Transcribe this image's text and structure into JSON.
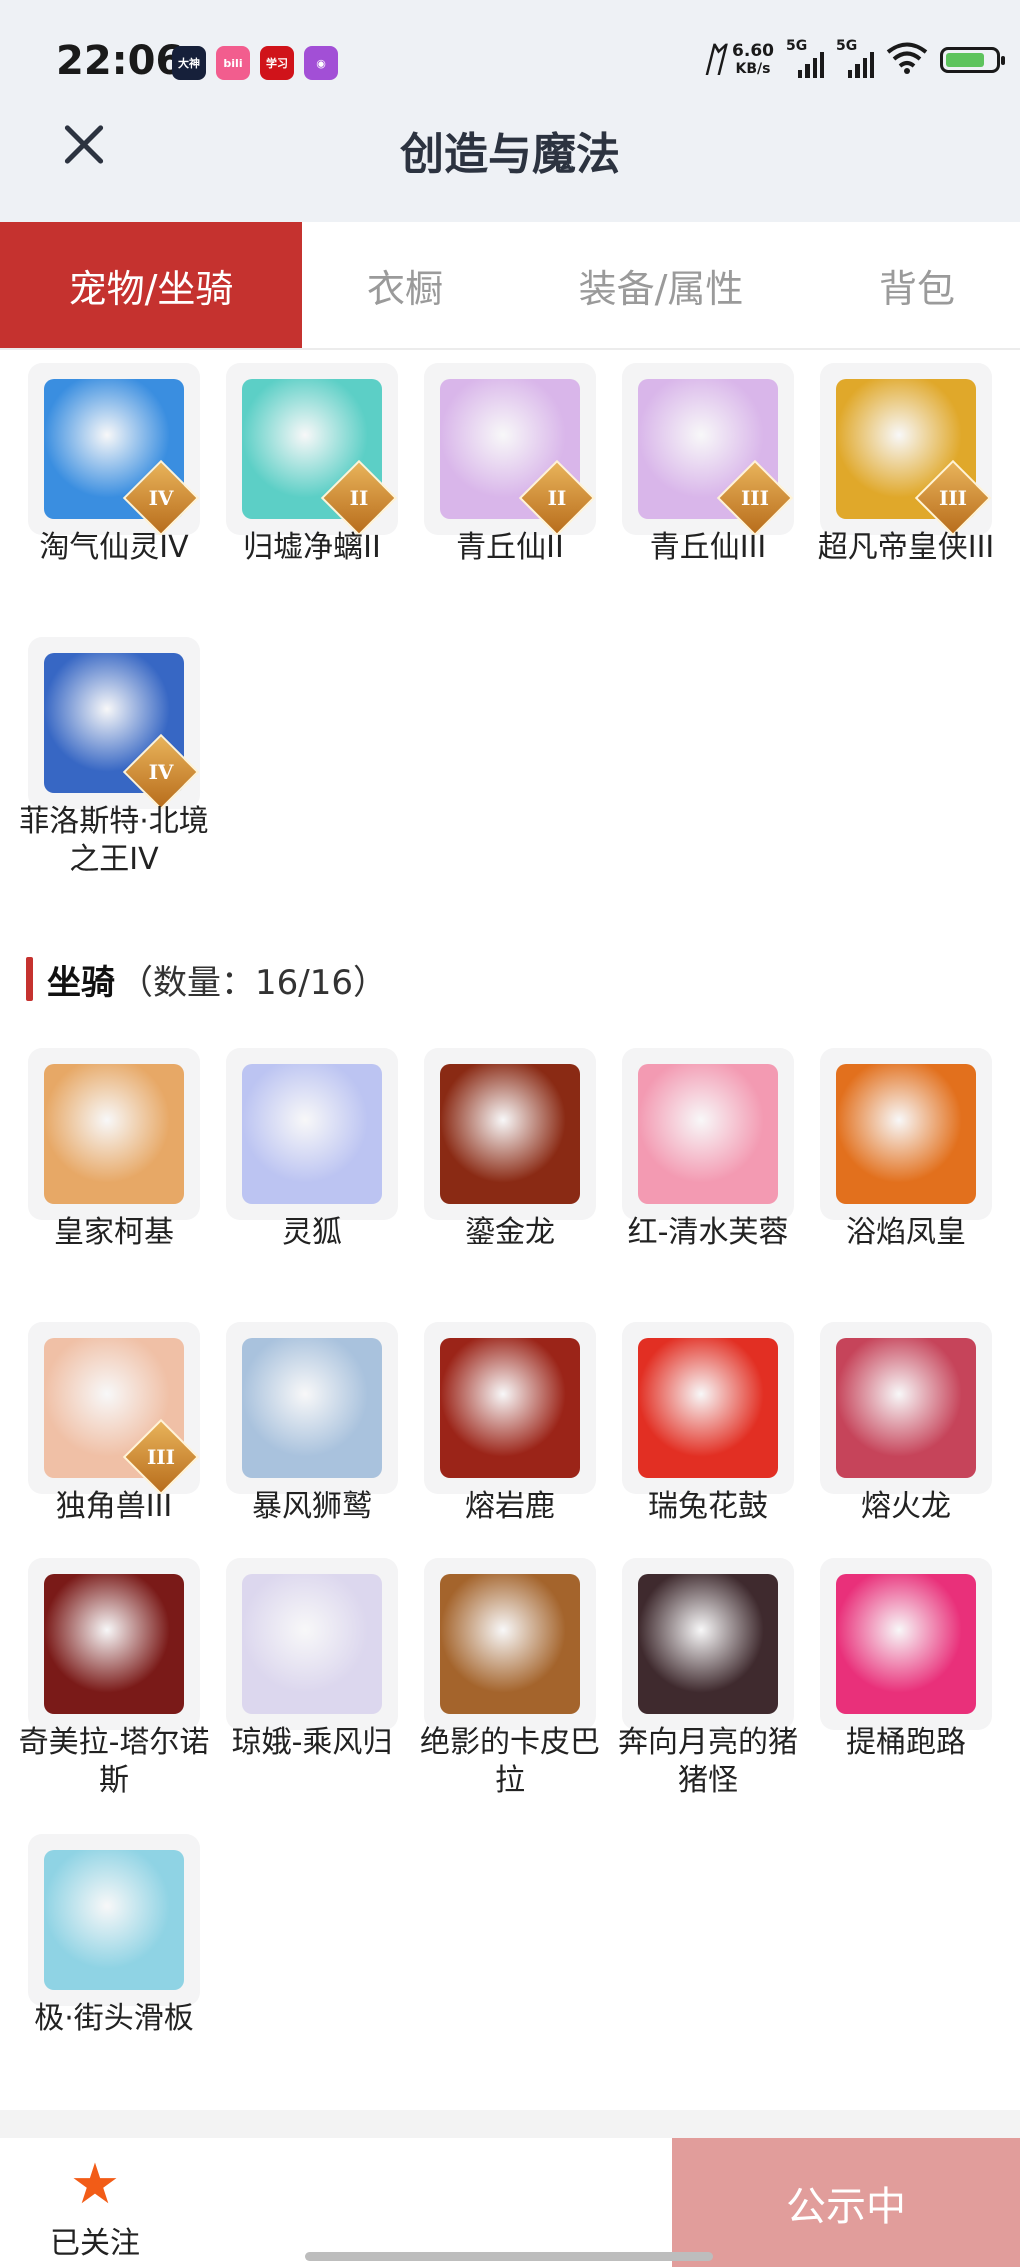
{
  "status_bar": {
    "time": "22:06",
    "apps": [
      {
        "name": "dashen-app-icon",
        "label": "大神",
        "color": "#16203a"
      },
      {
        "name": "bilibili-app-icon",
        "label": "bili",
        "color": "#f25d8e"
      },
      {
        "name": "xuexi-app-icon",
        "label": "学习",
        "color": "#d0131a"
      },
      {
        "name": "podcast-app-icon",
        "label": "◉",
        "color": "#a24fd6"
      }
    ],
    "net_speed_value": "6.60",
    "net_speed_unit": "KB/s",
    "signal1_label": "5G",
    "signal2_label": "5G",
    "battery_color": "#5dc35d"
  },
  "header": {
    "title": "创造与魔法",
    "close_icon": "close-icon"
  },
  "tabs": [
    {
      "label": "宠物/坐骑",
      "active": true
    },
    {
      "label": "衣橱",
      "active": false
    },
    {
      "label": "装备/属性",
      "active": false
    },
    {
      "label": "背包",
      "active": false
    }
  ],
  "pets": [
    {
      "name": "淘气仙灵IV",
      "badge": "IV",
      "icon": "blue-puppy-icon",
      "bg": "#3a8ee0"
    },
    {
      "name": "归墟净螭II",
      "badge": "II",
      "icon": "cyan-dragon-icon",
      "bg": "#5ccfc6"
    },
    {
      "name": "青丘仙II",
      "badge": "II",
      "icon": "fox-fairy-icon",
      "bg": "#d9b6ea"
    },
    {
      "name": "青丘仙III",
      "badge": "III",
      "icon": "fox-fairy-icon",
      "bg": "#d9b6ea"
    },
    {
      "name": "超凡帝皇侠III",
      "badge": "III",
      "icon": "golden-armor-icon",
      "bg": "#e0a82a"
    },
    {
      "name": "菲洛斯特·北境之王IV",
      "badge": "IV",
      "icon": "frost-king-icon",
      "bg": "#3767c4"
    }
  ],
  "mounts_section": {
    "title": "坐骑",
    "count": "（数量：16/16）"
  },
  "mounts": [
    {
      "name": "皇家柯基",
      "icon": "corgi-icon",
      "bg": "#e7a866"
    },
    {
      "name": "灵狐",
      "icon": "spirit-fox-icon",
      "bg": "#bcc4f2"
    },
    {
      "name": "鎏金龙",
      "icon": "gold-dragon-icon",
      "bg": "#8a2a14"
    },
    {
      "name": "红-清水芙蓉",
      "icon": "lotus-icon",
      "bg": "#f39ab2"
    },
    {
      "name": "浴焰凤皇",
      "icon": "phoenix-icon",
      "bg": "#e2701d"
    },
    {
      "name": "独角兽III",
      "badge": "III",
      "icon": "unicorn-icon",
      "bg": "#f0c0a6"
    },
    {
      "name": "暴风狮鹫",
      "icon": "griffin-icon",
      "bg": "#a9c2dd"
    },
    {
      "name": "熔岩鹿",
      "icon": "lava-deer-icon",
      "bg": "#9b2418"
    },
    {
      "name": "瑞兔花鼓",
      "icon": "rabbit-drum-icon",
      "bg": "#e22f23"
    },
    {
      "name": "熔火龙",
      "icon": "fire-dragon-icon",
      "bg": "#c6445a"
    },
    {
      "name": "奇美拉-塔尔诺斯",
      "icon": "chimera-icon",
      "bg": "#7a1a18"
    },
    {
      "name": "琼娥-乘风归",
      "icon": "moon-lady-icon",
      "bg": "#dcd7ee"
    },
    {
      "name": "绝影的卡皮巴拉",
      "icon": "capybara-icon",
      "bg": "#a4642c"
    },
    {
      "name": "奔向月亮的猪猪怪",
      "icon": "pig-monster-icon",
      "bg": "#3f2a2e"
    },
    {
      "name": "提桶跑路",
      "icon": "bucket-icon",
      "bg": "#e9307a"
    },
    {
      "name": "极·街头滑板",
      "icon": "skateboard-icon",
      "bg": "#8fd3e4"
    }
  ],
  "bottom": {
    "follow_label": "已关注",
    "follow_icon": "star-icon",
    "publish_label": "公示中"
  }
}
